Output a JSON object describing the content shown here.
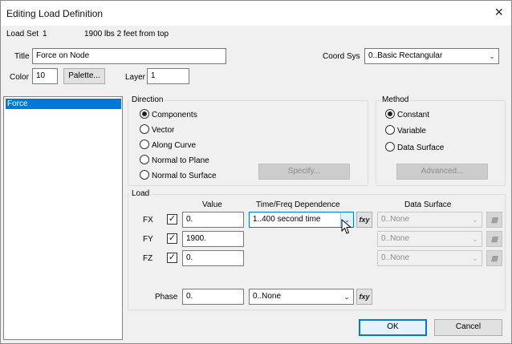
{
  "window": {
    "title": "Editing Load Definition",
    "close_glyph": "×"
  },
  "load_set": {
    "label": "Load Set",
    "number": "1",
    "name": "1900 lbs 2 feet from top"
  },
  "title_field": {
    "label": "Title",
    "value": "Force on Node"
  },
  "coord_sys": {
    "label": "Coord Sys",
    "value": "0..Basic Rectangular"
  },
  "color_field": {
    "label": "Color",
    "value": "10"
  },
  "palette_button": "Palette...",
  "layer_field": {
    "label": "Layer",
    "value": "1"
  },
  "load_types": {
    "selected": "Force"
  },
  "direction": {
    "title": "Direction",
    "options": [
      "Components",
      "Vector",
      "Along Curve",
      "Normal to Plane",
      "Normal to Surface"
    ],
    "selected": "Components",
    "specify_button": "Specify..."
  },
  "method": {
    "title": "Method",
    "options": [
      "Constant",
      "Variable",
      "Data Surface"
    ],
    "selected": "Constant",
    "advanced_button": "Advanced..."
  },
  "load": {
    "title": "Load",
    "headers": {
      "value": "Value",
      "time_freq": "Time/Freq Dependence",
      "data_surface": "Data Surface"
    },
    "rows": [
      {
        "label": "FX",
        "checked": true,
        "value": "0.",
        "time_freq": "1..400 second time",
        "data_surface": "0..None"
      },
      {
        "label": "FY",
        "checked": true,
        "value": "1900.",
        "data_surface": "0..None"
      },
      {
        "label": "FZ",
        "checked": true,
        "value": "0.",
        "data_surface": "0..None"
      }
    ],
    "phase": {
      "label": "Phase",
      "value": "0.",
      "function": "0..None"
    },
    "fxy_label": "fxy"
  },
  "buttons": {
    "ok": "OK",
    "cancel": "Cancel"
  },
  "icons": {
    "combo_arrow": "chevron-down-icon",
    "check": "check-icon",
    "data_surface_picker": "table-icon"
  }
}
